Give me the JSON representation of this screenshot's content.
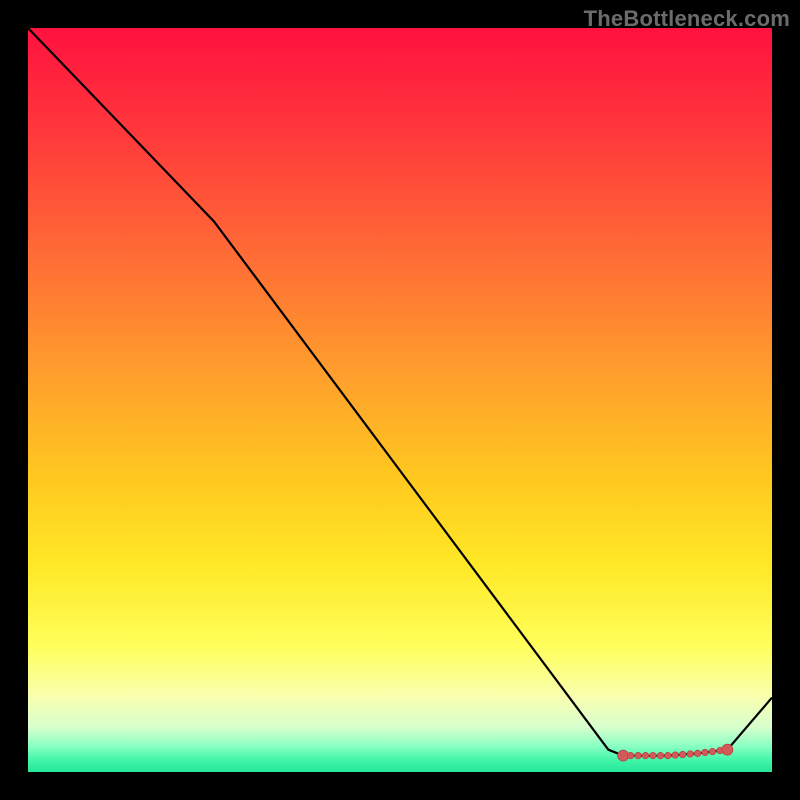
{
  "watermark": "TheBottleneck.com",
  "chart_data": {
    "type": "line",
    "title": "",
    "xlabel": "",
    "ylabel": "",
    "xlim": [
      0,
      100
    ],
    "ylim": [
      0,
      100
    ],
    "x": [
      0,
      25,
      78,
      80,
      86,
      90,
      94,
      100
    ],
    "values": [
      100,
      74,
      3.0,
      2.2,
      2.2,
      2.5,
      3.0,
      10
    ],
    "optimum_band_x": [
      80,
      94
    ],
    "optimum_markers_x": [
      80,
      81,
      82,
      83,
      84,
      85,
      86,
      87,
      88,
      89,
      90,
      91,
      92,
      93,
      94
    ],
    "gradient_stops": [
      {
        "offset": 0.0,
        "color": "#ff113f"
      },
      {
        "offset": 0.15,
        "color": "#ff3b3b"
      },
      {
        "offset": 0.3,
        "color": "#ff6a35"
      },
      {
        "offset": 0.45,
        "color": "#ff9a2e"
      },
      {
        "offset": 0.6,
        "color": "#ffc71f"
      },
      {
        "offset": 0.72,
        "color": "#ffe826"
      },
      {
        "offset": 0.83,
        "color": "#ffff5a"
      },
      {
        "offset": 0.9,
        "color": "#f8ffb0"
      },
      {
        "offset": 0.94,
        "color": "#d8ffce"
      },
      {
        "offset": 0.965,
        "color": "#8affc2"
      },
      {
        "offset": 0.985,
        "color": "#3ff5a8"
      },
      {
        "offset": 1.0,
        "color": "#26e69a"
      }
    ],
    "curve_stroke": "#000000",
    "marker_fill": "#d45a5a",
    "marker_stroke": "#b84444"
  }
}
